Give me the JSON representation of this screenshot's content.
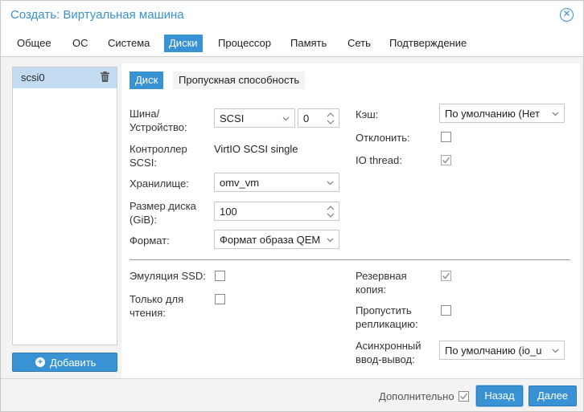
{
  "window": {
    "title": "Создать: Виртуальная машина"
  },
  "tabs": [
    "Общее",
    "ОС",
    "Система",
    "Диски",
    "Процессор",
    "Память",
    "Сеть",
    "Подтверждение"
  ],
  "active_tab": "Диски",
  "disks": {
    "items": [
      {
        "name": "scsi0",
        "selected": true
      }
    ],
    "add_label": "Добавить"
  },
  "subtabs": [
    "Диск",
    "Пропускная способность"
  ],
  "active_subtab": "Диск",
  "form": {
    "bus": {
      "label_line1": "Шина/",
      "label_line2": "Устройство:",
      "bus_value": "SCSI",
      "device_value": "0"
    },
    "controller": {
      "label_line1": "Контроллер",
      "label_line2": "SCSI:",
      "value": "VirtIO SCSI single"
    },
    "storage": {
      "label": "Хранилище:",
      "value": "omv_vm"
    },
    "size": {
      "label_line1": "Размер диска",
      "label_line2": "(GiB):",
      "value": "100"
    },
    "format": {
      "label": "Формат:",
      "value": "Формат образа QEM"
    },
    "cache": {
      "label": "Кэш:",
      "value": "По умолчанию (Нет"
    },
    "discard": {
      "label": "Отклонить:",
      "checked": false
    },
    "iothread": {
      "label": "IO thread:",
      "checked": true
    },
    "ssd": {
      "label": "Эмуляция SSD:",
      "checked": false
    },
    "readonly": {
      "label_line1": "Только для",
      "label_line2": "чтения:",
      "checked": false
    },
    "backup": {
      "label_line1": "Резервная",
      "label_line2": "копия:",
      "checked": true
    },
    "skip_replication": {
      "label_line1": "Пропустить",
      "label_line2": "репликацию:",
      "checked": false
    },
    "async_io": {
      "label_line1": "Асинхронный",
      "label_line2": "ввод-вывод:",
      "value": "По умолчанию (io_u"
    }
  },
  "footer": {
    "advanced_label": "Дополнительно",
    "advanced_checked": true,
    "back_label": "Назад",
    "next_label": "Далее"
  },
  "colors": {
    "accent": "#3892d4",
    "selected_row": "#c4dcf1"
  },
  "icons": {
    "close": "close-circle-icon",
    "trash": "trash-icon",
    "add": "plus-circle-icon",
    "dropdown": "chevron-down-icon",
    "spinner": "spinner-arrows-icon",
    "check": "checkmark-icon"
  }
}
